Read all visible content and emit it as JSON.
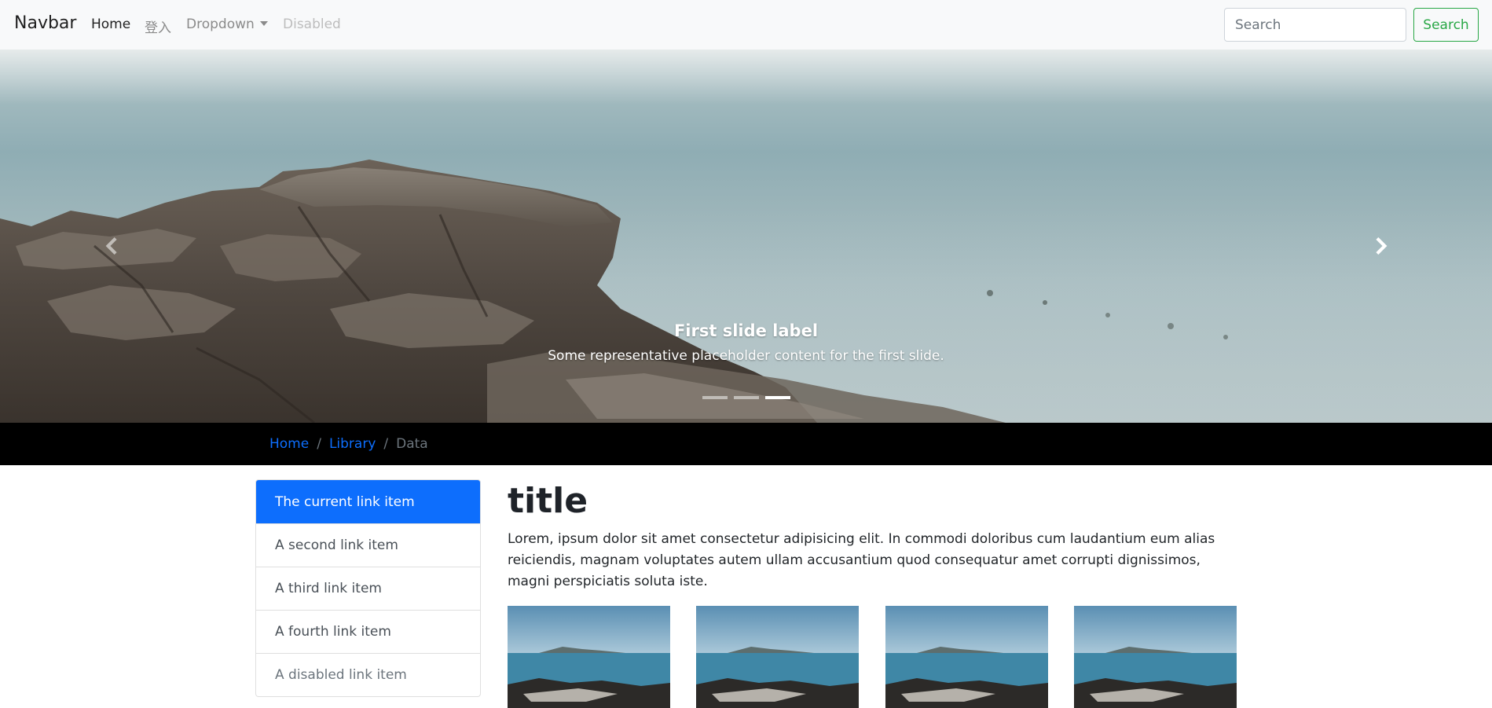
{
  "navbar": {
    "brand": "Navbar",
    "links": [
      {
        "label": "Home",
        "state": "active"
      },
      {
        "label": "登入",
        "state": "normal"
      },
      {
        "label": "Dropdown",
        "state": "dropdown"
      },
      {
        "label": "Disabled",
        "state": "disabled"
      }
    ],
    "search": {
      "placeholder": "Search",
      "value": "",
      "button_label": "Search"
    }
  },
  "carousel": {
    "caption_title": "First slide label",
    "caption_text": "Some representative placeholder content for the first slide.",
    "indicators": 3,
    "active_indicator": 2,
    "prev_icon": "chevron-left-icon",
    "next_icon": "chevron-right-icon"
  },
  "breadcrumb": {
    "items": [
      {
        "label": "Home",
        "link": true
      },
      {
        "label": "Library",
        "link": true
      },
      {
        "label": "Data",
        "link": false
      }
    ]
  },
  "sidebar": {
    "items": [
      {
        "label": "The current link item",
        "state": "active"
      },
      {
        "label": "A second link item",
        "state": "normal"
      },
      {
        "label": "A third link item",
        "state": "normal"
      },
      {
        "label": "A fourth link item",
        "state": "normal"
      },
      {
        "label": "A disabled link item",
        "state": "disabled"
      }
    ]
  },
  "main": {
    "title": "title",
    "text": "Lorem, ipsum dolor sit amet consectetur adipisicing elit. In commodi doloribus cum laudantium eum alias reiciendis, magnam voluptates autem ullam accusantium quod consequatur amet corrupti dignissimos, magni perspiciatis soluta iste.",
    "thumbnail_count": 4
  },
  "colors": {
    "primary": "#0d6efd",
    "success": "#28a745",
    "navbar_bg": "#f8f9fa",
    "breadcrumb_bg": "#000000"
  }
}
